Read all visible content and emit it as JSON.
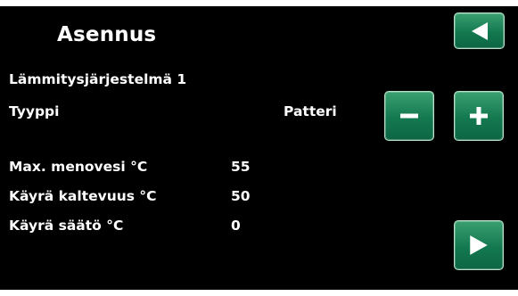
{
  "header": {
    "title": "Asennus"
  },
  "section": {
    "heading": "Lämmitysjärjestelmä 1"
  },
  "type_row": {
    "label": "Tyyppi",
    "value": "Patteri"
  },
  "settings": [
    {
      "label": "Max. menovesi °C",
      "value": "55"
    },
    {
      "label": "Käyrä kaltevuus °C",
      "value": "50"
    },
    {
      "label": "Käyrä säätö °C",
      "value": "0"
    }
  ],
  "buttons": {
    "back_icon": "triangle-left-icon",
    "minus_icon": "minus-icon",
    "plus_icon": "plus-icon",
    "next_icon": "triangle-right-icon"
  },
  "colors": {
    "background": "#000000",
    "button_green": "#13784f",
    "text": "#ffffff"
  }
}
